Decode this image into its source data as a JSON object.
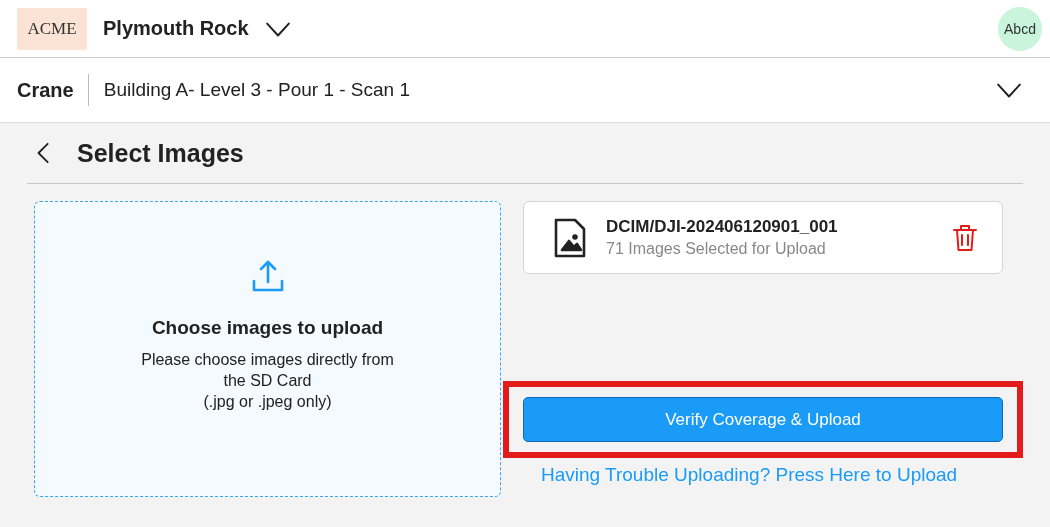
{
  "header": {
    "logo": "ACME",
    "project": "Plymouth Rock",
    "avatar": "Abcd"
  },
  "scan_bar": {
    "equipment": "Crane",
    "scan": "Building A- Level 3 - Pour 1 - Scan 1"
  },
  "page": {
    "title": "Select Images"
  },
  "dropzone": {
    "title": "Choose images to upload",
    "lines": [
      "Please choose images directly from",
      "the SD Card",
      "(.jpg or .jpeg only)"
    ]
  },
  "folder": {
    "path": "DCIM/DJI-202406120901_001",
    "count": "71 Images Selected for Upload"
  },
  "upload_button": {
    "label": "Verify Coverage & Upload",
    "highlighted": true
  },
  "help_link": "Having Trouble Uploading? Press Here to Upload"
}
